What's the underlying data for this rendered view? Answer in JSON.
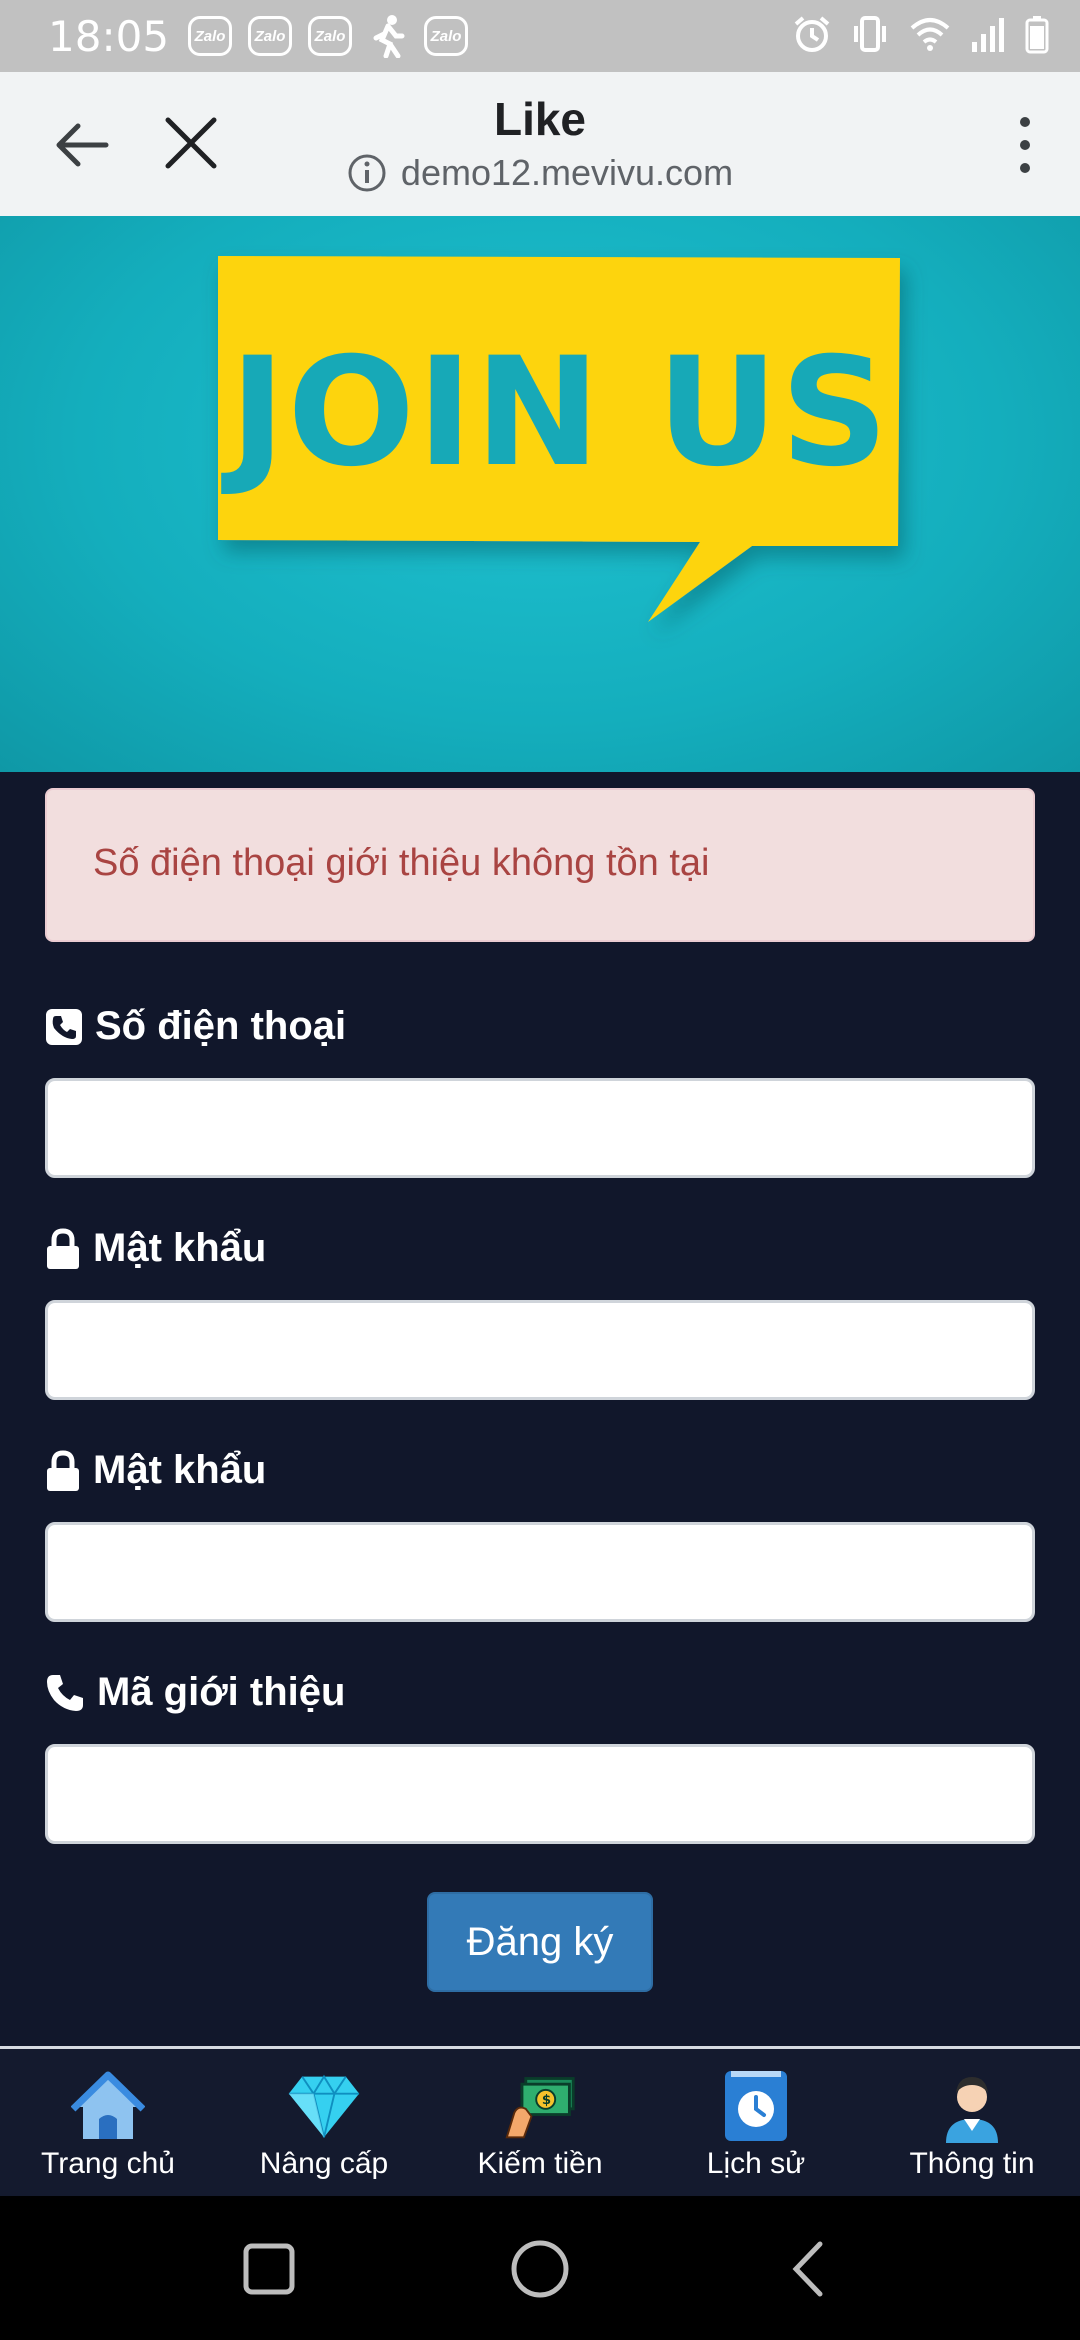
{
  "status_bar": {
    "time": "18:05",
    "notifications": [
      "Zalo",
      "Zalo",
      "Zalo",
      "walking-icon",
      "Zalo"
    ],
    "icons_right": [
      "alarm-icon",
      "vibrate-icon",
      "wifi-icon",
      "signal-icon",
      "battery-icon"
    ]
  },
  "browser": {
    "title": "Like",
    "url": "demo12.mevivu.com"
  },
  "hero": {
    "text": "JOIN US",
    "background_color": "#14aebd",
    "bubble_color": "#fdd40a"
  },
  "alert": {
    "message": "Số điện thoại giới thiệu không tồn tại"
  },
  "form": {
    "phone_label": "Số điện thoại",
    "password_label": "Mật khẩu",
    "confirm_password_label": "Mật khẩu",
    "referral_label": "Mã giới thiệu",
    "phone_value": "",
    "password_value": "",
    "confirm_password_value": "",
    "referral_value": "",
    "submit_label": "Đăng ký"
  },
  "bottom_nav": [
    {
      "label": "Trang chủ",
      "icon": "home-icon"
    },
    {
      "label": "Nâng cấp",
      "icon": "diamond-icon"
    },
    {
      "label": "Kiếm tiền",
      "icon": "money-icon"
    },
    {
      "label": "Lịch sử",
      "icon": "history-icon"
    },
    {
      "label": "Thông tin",
      "icon": "user-icon"
    }
  ],
  "colors": {
    "page_bg": "#11172b",
    "alert_bg": "#f2dede",
    "alert_text": "#a94442",
    "button_bg": "#337ab7"
  }
}
